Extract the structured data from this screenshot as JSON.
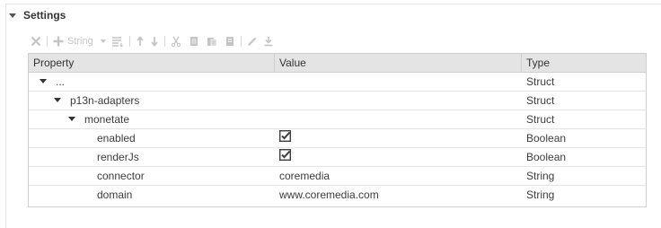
{
  "section": {
    "title": "Settings"
  },
  "toolbar": {
    "type_selector": "String",
    "icons": [
      "delete-icon",
      "add-icon",
      "type-dropdown",
      "sort-icon",
      "move-up-icon",
      "move-down-icon",
      "cut-icon",
      "copy-icon",
      "paste-icon",
      "paste-special-icon",
      "edit-icon",
      "download-icon"
    ]
  },
  "table": {
    "columns": [
      "Property",
      "Value",
      "Type"
    ],
    "rows": [
      {
        "property": "...",
        "value": "",
        "type": "Struct",
        "expandable": true
      },
      {
        "property": "p13n-adapters",
        "value": "",
        "type": "Struct",
        "expandable": true
      },
      {
        "property": "monetate",
        "value": "",
        "type": "Struct",
        "expandable": true
      },
      {
        "property": "enabled",
        "value": "",
        "checked": true,
        "type": "Boolean"
      },
      {
        "property": "renderJs",
        "value": "",
        "checked": true,
        "type": "Boolean"
      },
      {
        "property": "connector",
        "value": "coremedia",
        "type": "String"
      },
      {
        "property": "domain",
        "value": "www.coremedia.com",
        "type": "String"
      }
    ]
  }
}
